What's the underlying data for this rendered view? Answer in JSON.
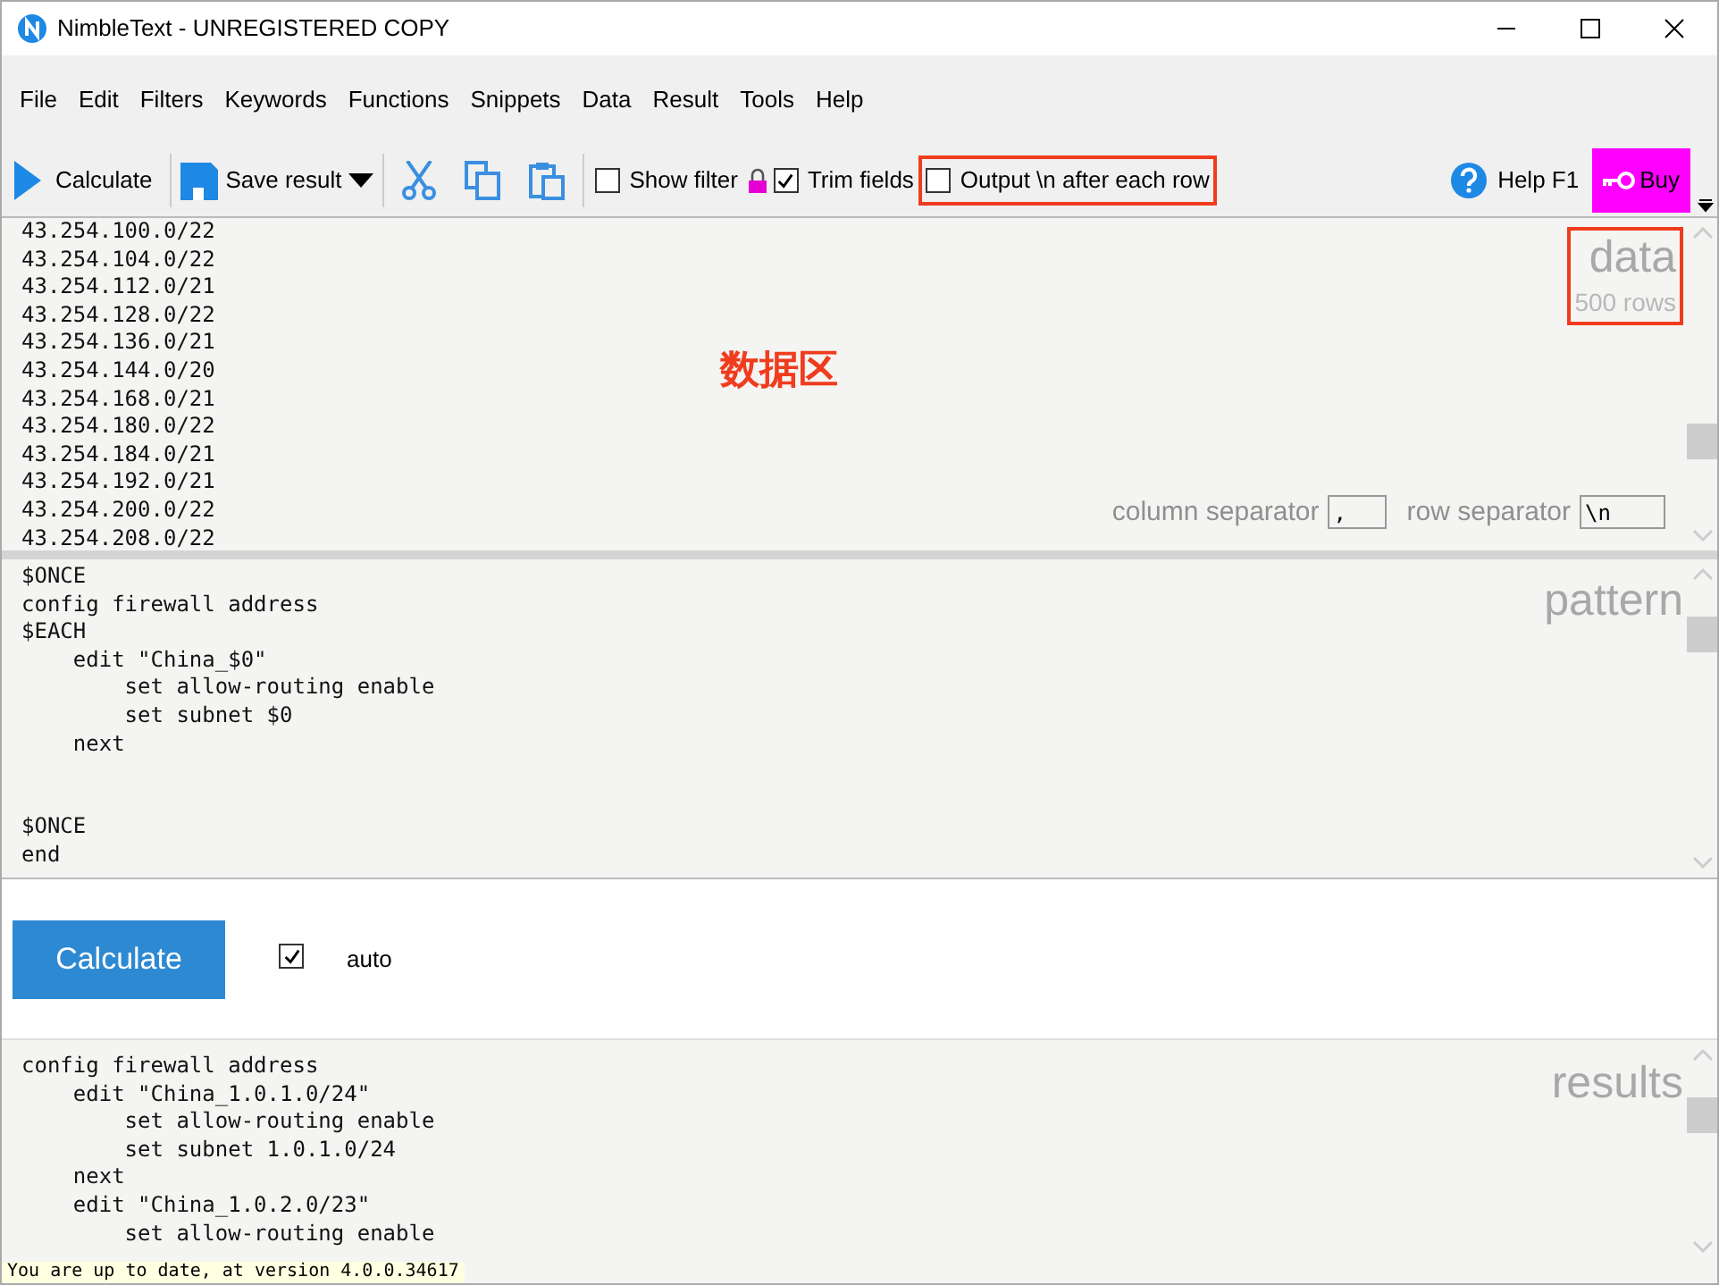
{
  "window": {
    "title": "NimbleText - UNREGISTERED COPY"
  },
  "menu": [
    "File",
    "Edit",
    "Filters",
    "Keywords",
    "Functions",
    "Snippets",
    "Data",
    "Result",
    "Tools",
    "Help"
  ],
  "toolbar": {
    "calculate": "Calculate",
    "save": "Save result",
    "checkboxes": [
      {
        "label": "Show filter",
        "checked": false,
        "highlighted": false
      },
      {
        "label": "Trim fields",
        "checked": true,
        "highlighted": false
      },
      {
        "label": "Output \\n after each row",
        "checked": false,
        "highlighted": true
      }
    ],
    "help": "Help F1",
    "buy": "Buy"
  },
  "data": {
    "label": "data",
    "count": "500 rows",
    "highlighted": true,
    "annotation": "数据区",
    "text": "43.254.100.0/22\n43.254.104.0/22\n43.254.112.0/21\n43.254.128.0/22\n43.254.136.0/21\n43.254.144.0/20\n43.254.168.0/21\n43.254.180.0/22\n43.254.184.0/21\n43.254.192.0/21\n43.254.200.0/22\n43.254.208.0/22",
    "column_separator": {
      "label": "column separator",
      "value": ","
    },
    "row_separator": {
      "label": "row separator",
      "value": "\\n"
    }
  },
  "pattern": {
    "label": "pattern",
    "text": "$ONCE\nconfig firewall address\n$EACH\n    edit \"China_$0\"\n        set allow-routing enable\n        set subnet $0\n    next\n\n\n$ONCE\nend"
  },
  "run": {
    "button": "Calculate",
    "auto": {
      "label": "auto",
      "checked": true
    }
  },
  "results": {
    "label": "results",
    "text": "config firewall address\n    edit \"China_1.0.1.0/24\"\n        set allow-routing enable\n        set subnet 1.0.1.0/24\n    next\n    edit \"China_1.0.2.0/23\"\n        set allow-routing enable"
  },
  "status_bar": "You are up to date, at version 4.0.0.34617"
}
